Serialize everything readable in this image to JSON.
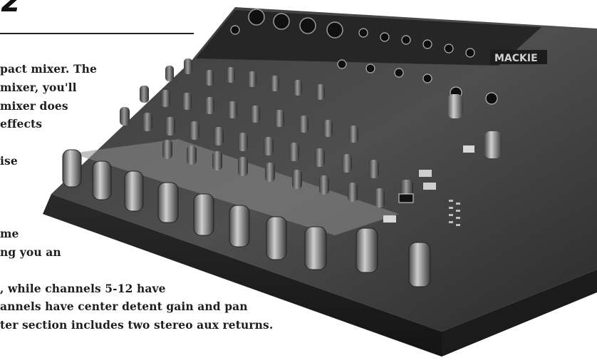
{
  "article": {
    "heading": "z",
    "lines": [
      "pact mixer. The",
      "mixer, you'll",
      "mixer does",
      "effects",
      "ise",
      "me",
      "ng you an",
      ", while channels 5-12 have",
      "annels have center detent gain and pan",
      "ter section includes two stereo aux returns."
    ]
  },
  "photo": {
    "subject": "mixer-photo",
    "brand_mark": "MACKIE"
  },
  "colors": {
    "body_dark": "#2b2b2b",
    "panel": "#4a4a4a",
    "knob": "#707070",
    "knob_light": "#b8b8b8"
  }
}
